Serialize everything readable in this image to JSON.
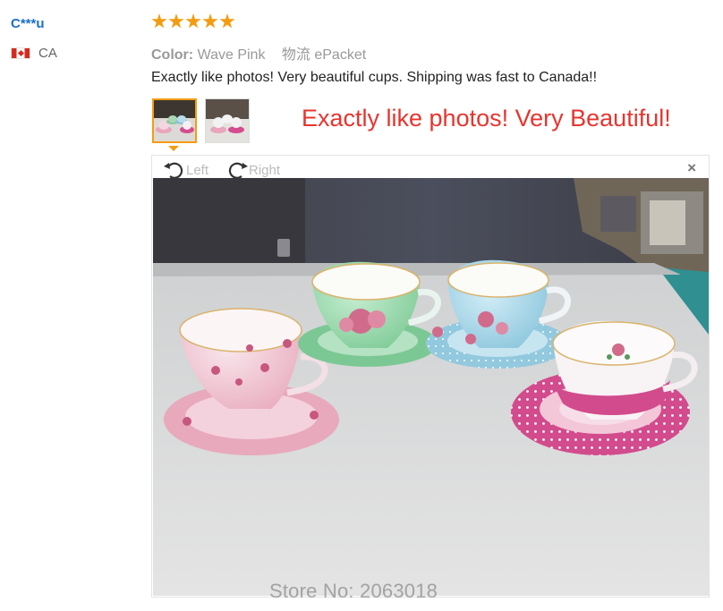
{
  "reviewer": {
    "name": "C***u",
    "country_code": "CA",
    "flag_icon": "canada-flag-icon"
  },
  "review": {
    "rating": 5,
    "star_color": "#f39c12",
    "color_label": "Color:",
    "color_value": "Wave Pink",
    "shipping_label": "物流",
    "shipping_value": "ePacket",
    "text": "Exactly like photos! Very beautiful cups. Shipping was fast to Canada!!"
  },
  "thumbnails": [
    {
      "name": "review-photo-1",
      "selected": true
    },
    {
      "name": "review-photo-2",
      "selected": false
    }
  ],
  "photo_caption": "Exactly like photos! Very Beautiful!",
  "viewer": {
    "rotate_left_label": "Left",
    "rotate_right_label": "Right",
    "close_glyph": "×",
    "watermark": "Store No: 2063018"
  },
  "colors": {
    "username": "#1a6fc9",
    "caption": "#e8342e",
    "selected_border": "#f39c12"
  }
}
